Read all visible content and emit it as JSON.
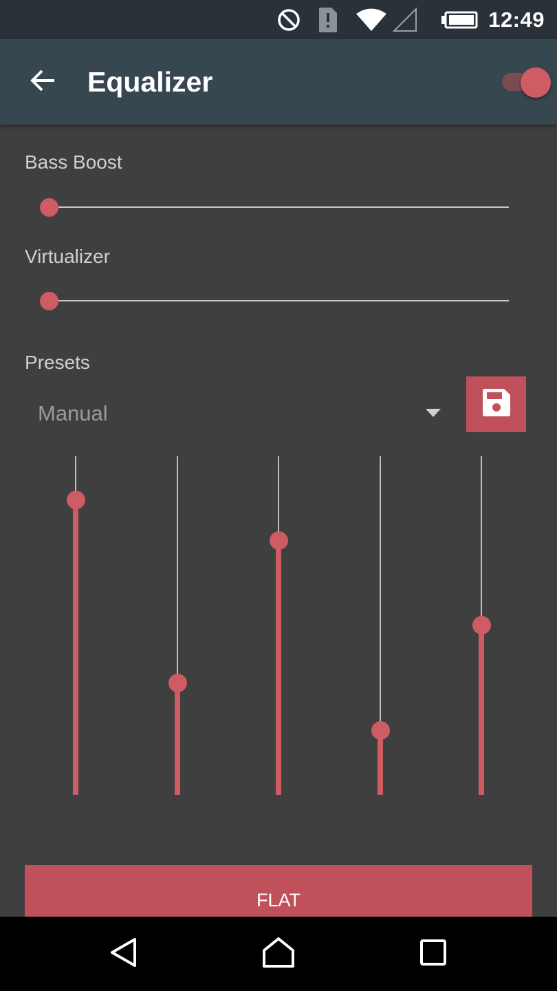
{
  "status_bar": {
    "time": "12:49",
    "icons": [
      "do-not-disturb-icon",
      "sim-alert-icon",
      "wifi-icon",
      "cell-signal-icon",
      "battery-icon"
    ]
  },
  "app_bar": {
    "title": "Equalizer",
    "back_icon": "arrow-back-icon",
    "toggle_on": true
  },
  "effects": {
    "bass_boost": {
      "label": "Bass Boost",
      "value": 0
    },
    "virtualizer": {
      "label": "Virtualizer",
      "value": 0
    }
  },
  "presets": {
    "label": "Presets",
    "selected": "Manual",
    "save_icon": "save-icon"
  },
  "equalizer": {
    "bands": [
      {
        "level": 0.87
      },
      {
        "level": 0.33
      },
      {
        "level": 0.75
      },
      {
        "level": 0.19
      },
      {
        "level": 0.5
      }
    ]
  },
  "flat_button": {
    "label": "FLAT"
  },
  "nav_bar": {
    "icons": [
      "back-icon",
      "home-icon",
      "recents-icon"
    ]
  },
  "colors": {
    "accent": "#cd5c64",
    "button": "#c0505a",
    "app_bar": "#37474f",
    "status_bar": "#293239",
    "background": "#3f3f3f"
  }
}
